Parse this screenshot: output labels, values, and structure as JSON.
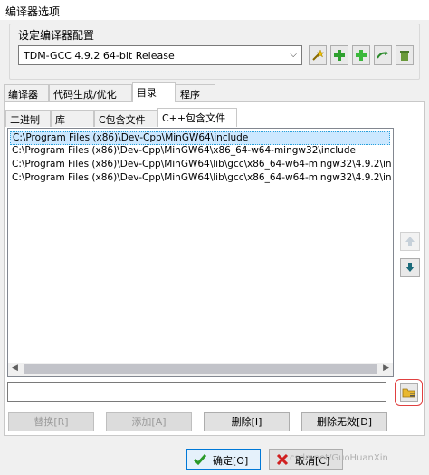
{
  "window": {
    "title": "编译器选项"
  },
  "compiler_set": {
    "group_label": "设定编译器配置",
    "selected": "TDM-GCC 4.9.2 64-bit Release"
  },
  "toolbar_icons": [
    "wand-icon",
    "add-green-icon",
    "add-plus-icon",
    "rename-arrow-icon",
    "delete-trash-icon"
  ],
  "tabs": [
    {
      "label": "编译器",
      "active": false
    },
    {
      "label": "代码生成/优化",
      "active": false
    },
    {
      "label": "目录",
      "active": true
    },
    {
      "label": "程序",
      "active": false
    }
  ],
  "subtabs": [
    {
      "label": "二进制",
      "active": false
    },
    {
      "label": "库",
      "active": false
    },
    {
      "label": "C包含文件",
      "active": false
    },
    {
      "label": "C++包含文件",
      "active": true
    }
  ],
  "dirs": [
    "C:\\Program Files (x86)\\Dev-Cpp\\MinGW64\\include",
    "C:\\Program Files (x86)\\Dev-Cpp\\MinGW64\\x86_64-w64-mingw32\\include",
    "C:\\Program Files (x86)\\Dev-Cpp\\MinGW64\\lib\\gcc\\x86_64-w64-mingw32\\4.9.2\\in",
    "C:\\Program Files (x86)\\Dev-Cpp\\MinGW64\\lib\\gcc\\x86_64-w64-mingw32\\4.9.2\\in"
  ],
  "path_input": {
    "value": ""
  },
  "actions": {
    "replace": "替换[R]",
    "add": "添加[A]",
    "delete": "删除[I]",
    "delete_invalid": "删除无效[D]"
  },
  "dialog_buttons": {
    "ok": "确定[O]",
    "cancel": "取消[C]"
  },
  "watermark": "csdn.net/GuoHuanXin"
}
